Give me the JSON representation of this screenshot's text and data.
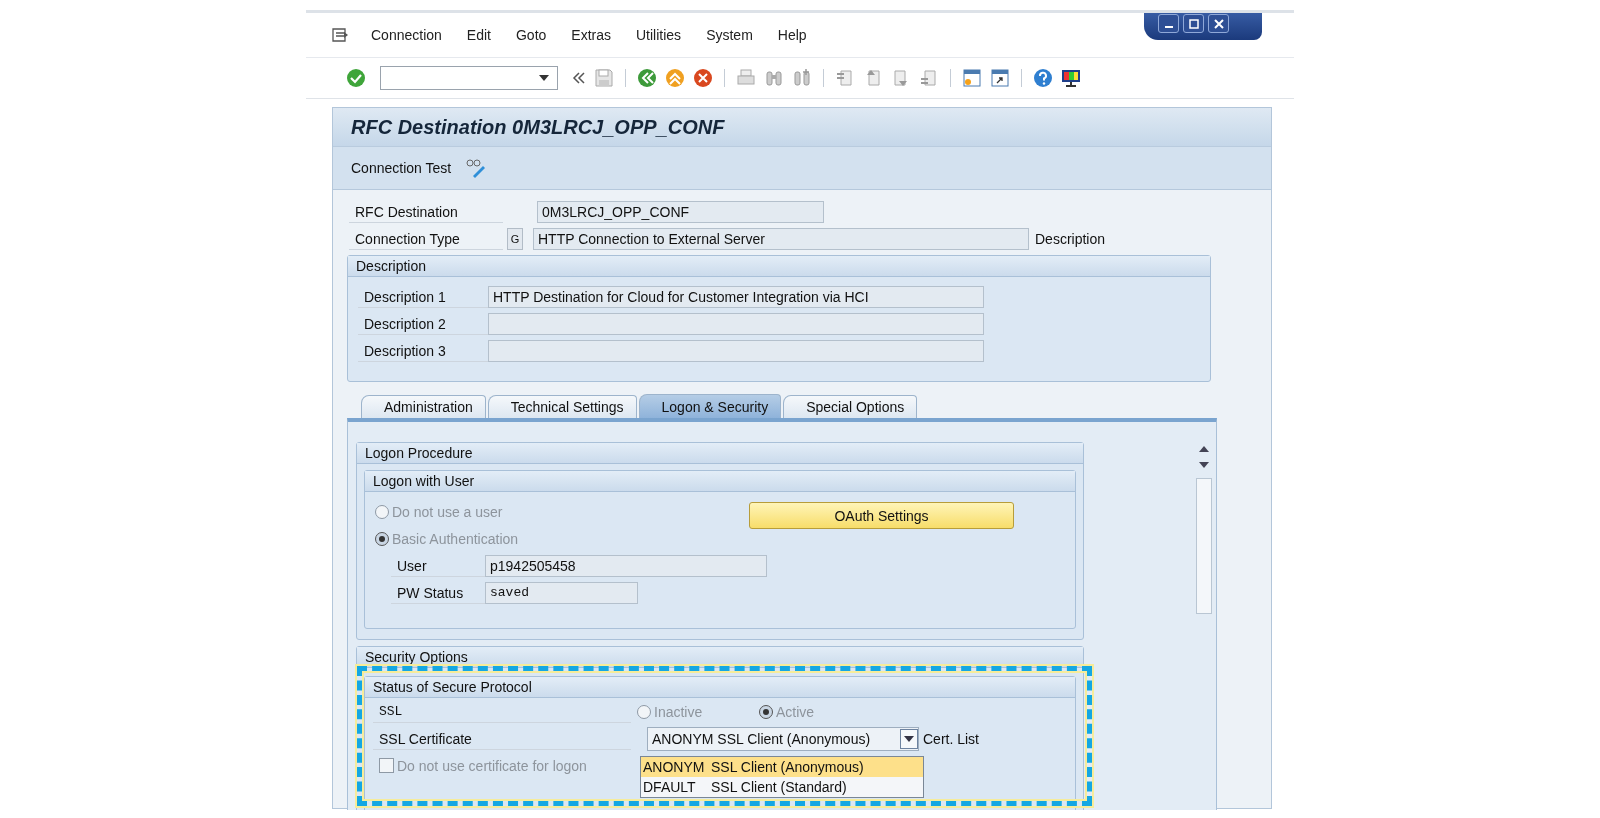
{
  "menu_bar": {
    "items": [
      {
        "label": "Connection"
      },
      {
        "label": "Edit"
      },
      {
        "label": "Goto"
      },
      {
        "label": "Extras"
      },
      {
        "label": "Utilities"
      },
      {
        "label": "System"
      },
      {
        "label": "Help"
      }
    ]
  },
  "screen": {
    "title": "RFC Destination 0M3LRCJ_OPP_CONF",
    "actions": [
      {
        "label": "Connection Test"
      }
    ]
  },
  "header_fields": [
    {
      "label": "RFC Destination",
      "value": "0M3LRCJ_OPP_CONF"
    },
    {
      "label": "Connection Type",
      "code": "G",
      "value": "HTTP Connection to External Server",
      "suffix": "Description"
    }
  ],
  "description_group": {
    "title": "Description",
    "fields": [
      {
        "label": "Description 1",
        "value": "HTTP Destination for Cloud for Customer Integration via HCI"
      },
      {
        "label": "Description 2"
      },
      {
        "label": "Description 3"
      }
    ]
  },
  "tabs": [
    {
      "label": "Administration",
      "selected": false
    },
    {
      "label": "Technical Settings",
      "selected": false
    },
    {
      "label": "Logon & Security",
      "selected": true
    },
    {
      "label": "Special Options",
      "selected": false
    }
  ],
  "logon_procedure": {
    "title": "Logon Procedure",
    "subgroup_title": "Logon with User",
    "options": [
      {
        "label": "Do not use a user",
        "selected": false,
        "disabled": true
      },
      {
        "label": "Basic Authentication",
        "selected": true,
        "disabled": true
      }
    ],
    "oauth_button": "OAuth Settings",
    "fields": [
      {
        "label": "User",
        "value": "p1942505458"
      },
      {
        "label": "PW Status",
        "value": "saved"
      }
    ]
  },
  "security_options": {
    "title": "Security Options",
    "subgroup_title": "Status of Secure Protocol",
    "ssl_label": "SSL",
    "ssl_options": [
      {
        "label": "Inactive",
        "selected": false,
        "disabled": true
      },
      {
        "label": "Active",
        "selected": true,
        "disabled": true
      }
    ],
    "certificate_label": "SSL Certificate",
    "certificate_value": "ANONYM SSL Client (Anonymous)",
    "cert_list_label": "Cert. List",
    "checkbox": {
      "label": "Do not use certificate for logon",
      "checked": false,
      "disabled": true
    },
    "dropdown_options": [
      {
        "code": "ANONYM",
        "label": "SSL Client (Anonymous)",
        "selected": true
      },
      {
        "code": "DFAULT",
        "label": "SSL Client (Standard)",
        "selected": false
      }
    ]
  }
}
